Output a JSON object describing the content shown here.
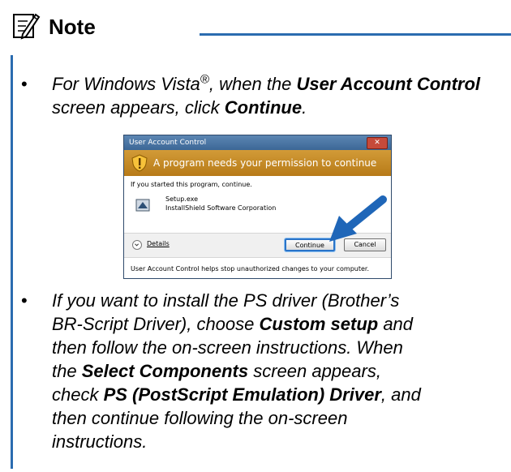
{
  "note": {
    "title": "Note"
  },
  "bullets": [
    {
      "parts": [
        "For Windows Vista",
        "®",
        ", when the ",
        "User Account Control",
        " screen appears, click ",
        "Continue",
        "."
      ]
    },
    {
      "line1a": "If you want to install the PS driver (Brother’s",
      "line2a": "BR-Script Driver), choose ",
      "line2b": "Custom setup",
      "line2c": " and",
      "line3": "then follow the on-screen instructions. When",
      "line4a": "the ",
      "line4b": "Select Components",
      "line4c": " screen appears,",
      "line5a": "check ",
      "line5b": "PS (PostScript Emulation) Driver",
      "line5c": ", and",
      "line6": "then continue following the on-screen",
      "line7": "instructions."
    }
  ],
  "dialog": {
    "title": "User Account Control",
    "close_glyph": "✕",
    "banner": "A program needs your permission to continue",
    "prompt": "If you started this program, continue.",
    "program_name": "Setup.exe",
    "publisher": "InstallShield Software Corporation",
    "details_label": "Details",
    "continue_label": "Continue",
    "cancel_label": "Cancel",
    "footer": "User Account Control helps stop unauthorized changes to your computer."
  },
  "colors": {
    "accent_blue": "#2b6cb0",
    "banner_orange": "#c4892a",
    "arrow_blue": "#1f66b8"
  },
  "icons": [
    "note-pencil-icon",
    "shield-icon",
    "setup-app-icon",
    "chevron-down-icon",
    "pointer-arrow-icon"
  ]
}
